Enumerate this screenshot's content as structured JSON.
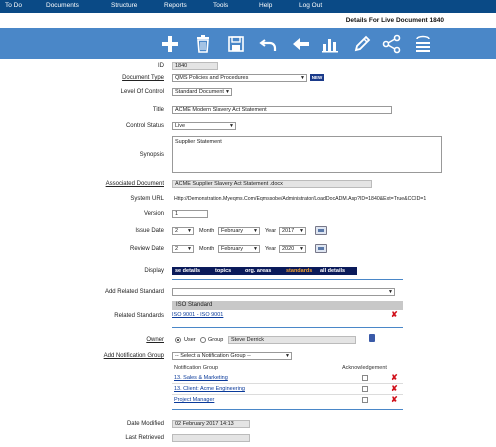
{
  "menu": [
    "To Do",
    "Documents",
    "Structure",
    "Reports",
    "Tools",
    "Help",
    "Log Out"
  ],
  "page_title": "Details For Live Document 1840",
  "toolbar_icons": [
    "add-icon",
    "delete-icon",
    "save-icon",
    "undo-icon",
    "back-icon",
    "chart-icon",
    "edit-icon",
    "share-icon",
    "stack-icon"
  ],
  "fields": {
    "id_label": "ID",
    "id_value": "1840",
    "doctype_label": "Document Type",
    "doctype_value": "QMS Policies and Procedures",
    "doctype_badge": "NEW",
    "level_label": "Level Of Control",
    "level_value": "Standard Document",
    "title_label": "Title",
    "title_value": "ACME Modern Slavery Act Statement",
    "status_label": "Control Status",
    "status_value": "Live",
    "synopsis_label": "Synopsis",
    "synopsis_value": "Supplier Statement",
    "assoc_label": "Associated Document",
    "assoc_value": "ACME Supplier Slavery Act Statement .docx",
    "url_label": "System URL",
    "url_value": "Http://Demonstration.Myeqms.Com/Eqmssobe/Administrator/LoadDocADM.Asp?ID=1840&Ext=True&CCID=1",
    "version_label": "Version",
    "version_value": "1",
    "issue_label": "Issue Date",
    "issue_day": "2",
    "issue_month_label": "Month",
    "issue_month": "February",
    "issue_year_label": "Year",
    "issue_year": "2017",
    "review_label": "Review Date",
    "review_day": "2",
    "review_month_label": "Month",
    "review_month": "February",
    "review_year_label": "Year",
    "review_year": "2020",
    "display_label": "Display",
    "display_options": [
      "se details",
      "topics",
      "org. areas",
      "standards",
      "all details"
    ],
    "add_std_label": "Add Related Standard",
    "add_std_value": "",
    "related_label": "Related Standards",
    "related_header": "ISO Standard",
    "related_items": [
      "ISO 9001 - ISO 9001"
    ],
    "owner_label": "Owner",
    "owner_user": "User",
    "owner_group": "Group",
    "owner_group_value": "Steve Derrick",
    "notif_label": "Add Notification Group",
    "notif_select": "-- Select a Notification Group --",
    "notif_col1": "Notification Group",
    "notif_col2": "Acknowledgement",
    "notif_items": [
      "13. Sales & Marketing",
      "13. Client: Acme Engineering",
      "Project Manager"
    ],
    "modified_label": "Date Modified",
    "modified_value": "02 February 2017 14:13",
    "retrieved_label": "Last Retrieved",
    "retrieved_value": ""
  }
}
